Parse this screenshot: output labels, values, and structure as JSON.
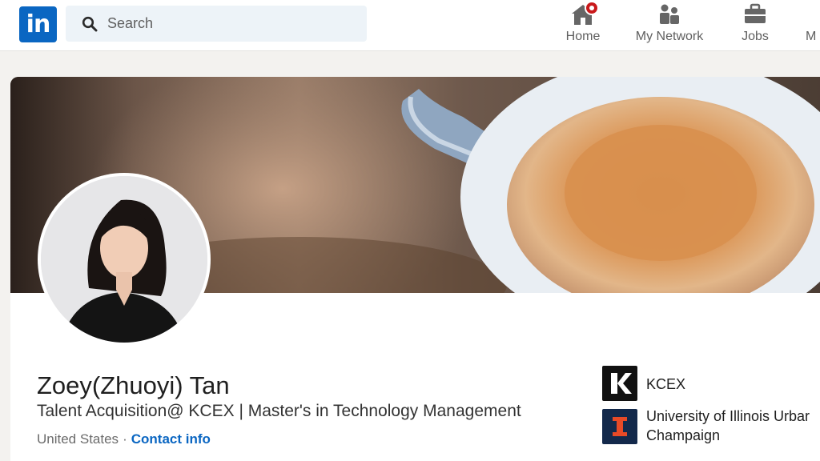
{
  "nav": {
    "logo_text": "in",
    "search_placeholder": "Search",
    "items": [
      {
        "label": "Home",
        "icon": "home-icon",
        "notification": true
      },
      {
        "label": "My Network",
        "icon": "people-icon"
      },
      {
        "label": "Jobs",
        "icon": "briefcase-icon"
      },
      {
        "label": "M"
      }
    ]
  },
  "profile": {
    "name": "Zoey(Zhuoyi) Tan",
    "headline": "Talent Acquisition@ KCEX | Master's in Technology Management",
    "location": "United States",
    "separator": "·",
    "contact_label": "Contact info",
    "banner": "coffee-cup-photo",
    "photo": "profile-photo"
  },
  "orgs": [
    {
      "name": "KCEX",
      "logo": "kcex-logo",
      "logo_text": "K"
    },
    {
      "name_line1": "University of Illinois Urbar",
      "name_line2": "Champaign",
      "logo": "university-logo",
      "logo_text": "I"
    }
  ],
  "colors": {
    "brand": "#0a66c2",
    "notification": "#c9181a",
    "search_bg": "#edf3f8",
    "page_bg": "#f3f2ef"
  }
}
